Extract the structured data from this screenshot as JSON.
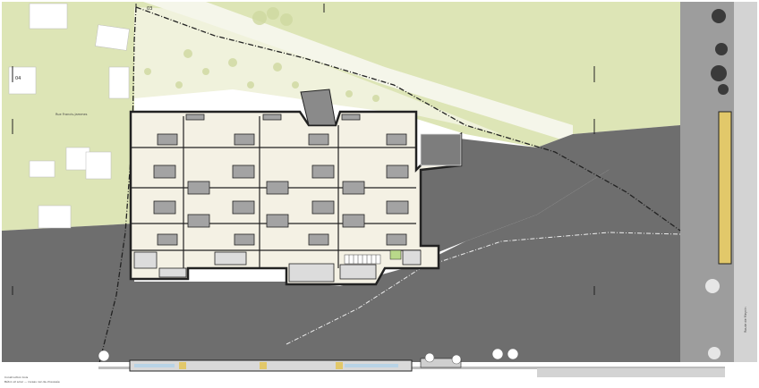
{
  "colors": {
    "meadow": "#dde5b6",
    "paved": "#6e6e6e",
    "building_fill": "#f4f1e4",
    "wall": "#222222",
    "room_dark": "#9a9a9a",
    "road_light": "#eef0e4",
    "path_dash": "#333333",
    "facade_yellow": "#e2c86a",
    "window_blue": "#b8d3e6"
  },
  "labels": {
    "street_left": "Rue Francis-Jammes",
    "street_bottom": "Rue de la Prairie",
    "street_right": "Route de Meyrin",
    "section_tag_top": "03",
    "section_tag_left": "04",
    "legend_line1": "Construction bois",
    "legend_line2": "Béton et acier — niveau rez-de-chaussée"
  },
  "icons": [
    "tree-icon",
    "section-marker-icon",
    "north-arrow-icon"
  ]
}
